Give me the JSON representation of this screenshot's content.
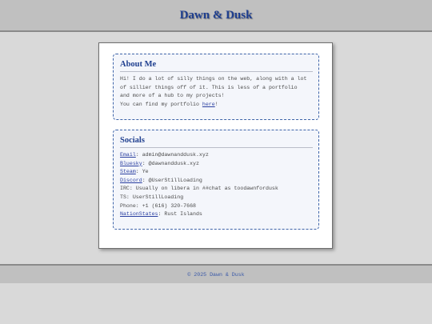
{
  "header": {
    "title": "Dawn & Dusk"
  },
  "about": {
    "title": "About Me",
    "lines": [
      "Hi! I do a lot of silly things on the web, along with a lot",
      "of sillier things off of it. This is less of a portfolio",
      "and more of a hub to my projects!"
    ],
    "portfolio_prefix": "You can find my portfolio ",
    "portfolio_link": "here",
    "portfolio_suffix": "!"
  },
  "socials": {
    "title": "Socials",
    "items": [
      {
        "label": "Email",
        "value": ": admin@dawnanddusk.xyz",
        "link": true
      },
      {
        "label": "Bluesky",
        "value": ": @dawnanddusk.xyz",
        "link": true
      },
      {
        "label": "Steam",
        "value": ": Ye",
        "link": true
      },
      {
        "label": "Discord",
        "value": ": @UserStillLoading",
        "link": true
      },
      {
        "label": "IRC",
        "value": ": Usually on libera in ##chat as toodawnfordusk",
        "link": false
      },
      {
        "label": "TS",
        "value": ": UserStillLoading",
        "link": false
      },
      {
        "label": "Phone",
        "value": ": +1 (616) 320-7668",
        "link": false
      },
      {
        "label": "NationStates",
        "value": ": Rust Islands",
        "link": true
      }
    ]
  },
  "footer": {
    "text": "© 2025 Dawn & Dusk"
  }
}
